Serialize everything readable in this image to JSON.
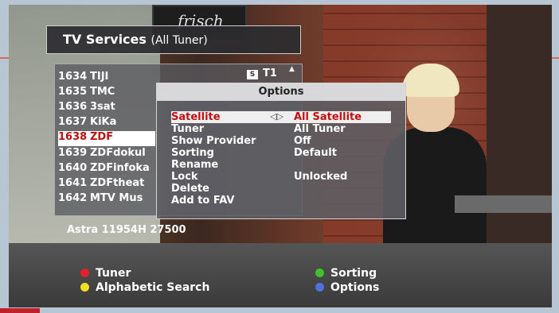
{
  "background": {
    "chalkboard_text": "frisch"
  },
  "service_list": {
    "title": "TV Services",
    "title_suffix": "(All Tuner)",
    "tuner_badge": "S",
    "tuner_label": "T1",
    "channels": [
      {
        "num": "1634",
        "name": "TIJI"
      },
      {
        "num": "1635",
        "name": "TMC"
      },
      {
        "num": "1636",
        "name": "3sat"
      },
      {
        "num": "1637",
        "name": "KiKa"
      },
      {
        "num": "1638",
        "name": "ZDF"
      },
      {
        "num": "1639",
        "name": "ZDFdokul"
      },
      {
        "num": "1640",
        "name": "ZDFinfoka"
      },
      {
        "num": "1641",
        "name": "ZDFtheat"
      },
      {
        "num": "1642",
        "name": "MTV Mus"
      }
    ],
    "selected_index": 4,
    "channel_info": "Astra    11954H 27500"
  },
  "options_menu": {
    "title": "Options",
    "items": [
      {
        "label": "Satellite",
        "value": "All Satellite"
      },
      {
        "label": "Tuner",
        "value": "All Tuner"
      },
      {
        "label": "Show Provider",
        "value": "Off"
      },
      {
        "label": "Sorting",
        "value": "Default"
      },
      {
        "label": "Rename",
        "value": ""
      },
      {
        "label": "Lock",
        "value": "Unlocked"
      },
      {
        "label": "Delete",
        "value": ""
      },
      {
        "label": "Add to FAV",
        "value": ""
      }
    ],
    "selected_arrows": "◁▷"
  },
  "footer": {
    "red": {
      "label": "Tuner",
      "color": "#e0202a"
    },
    "yellow": {
      "label": "Alphabetic Search",
      "color": "#f0e020"
    },
    "green": {
      "label": "Sorting",
      "color": "#40c030"
    },
    "blue": {
      "label": "Options",
      "color": "#5070e0"
    }
  }
}
